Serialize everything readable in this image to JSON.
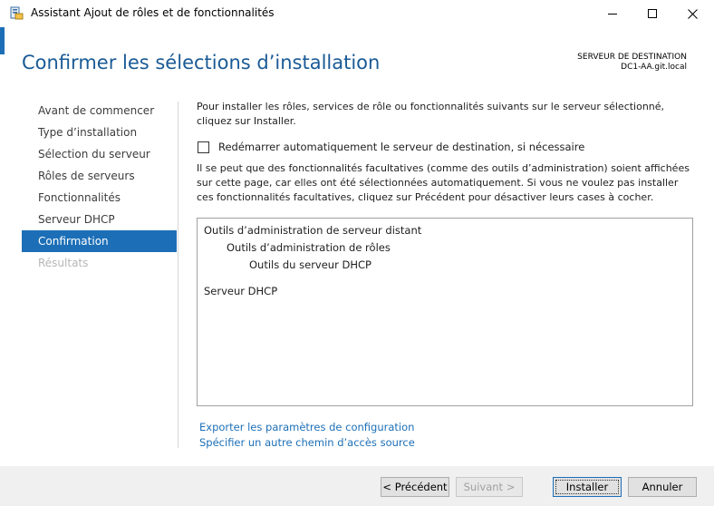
{
  "window": {
    "title": "Assistant Ajout de rôles et de fonctionnalités",
    "controls": {
      "minimize_icon": "minimize-icon",
      "maximize_icon": "maximize-icon",
      "close_icon": "close-icon"
    }
  },
  "header": {
    "title": "Confirmer les sélections d’installation",
    "destination_label": "SERVEUR DE DESTINATION",
    "destination_server": "DC1-AA.git.local"
  },
  "nav": {
    "items": [
      {
        "label": "Avant de commencer",
        "state": "normal"
      },
      {
        "label": "Type d’installation",
        "state": "normal"
      },
      {
        "label": "Sélection du serveur",
        "state": "normal"
      },
      {
        "label": "Rôles de serveurs",
        "state": "normal"
      },
      {
        "label": "Fonctionnalités",
        "state": "normal"
      },
      {
        "label": "Serveur DHCP",
        "state": "normal"
      },
      {
        "label": "Confirmation",
        "state": "active"
      },
      {
        "label": "Résultats",
        "state": "disabled"
      }
    ]
  },
  "main": {
    "intro": "Pour installer les rôles, services de rôle ou fonctionnalités suivants sur le serveur sélectionné, cliquez sur Installer.",
    "restart_checkbox": {
      "label": "Redémarrer automatiquement le serveur de destination, si nécessaire",
      "checked": false
    },
    "note": "Il se peut que des fonctionnalités facultatives (comme des outils d’administration) soient affichées sur cette page, car elles ont été sélectionnées automatiquement. Si vous ne voulez pas installer ces fonctionnalités facultatives, cliquez sur Précédent pour désactiver leurs cases à cocher.",
    "selections": [
      {
        "label": "Outils d’administration de serveur distant",
        "level": 0
      },
      {
        "label": "Outils d’administration de rôles",
        "level": 1
      },
      {
        "label": "Outils du serveur DHCP",
        "level": 2
      },
      {
        "label": "Serveur DHCP",
        "level": 0
      }
    ],
    "links": {
      "export": "Exporter les paramètres de configuration",
      "alt_source": "Spécifier un autre chemin d’accès source"
    }
  },
  "footer": {
    "previous": "< Précédent",
    "next": "Suivant >",
    "install": "Installer",
    "cancel": "Annuler"
  },
  "colors": {
    "accent": "#1c6fb7",
    "heading": "#1a5a96",
    "link": "#1c6fb7"
  }
}
